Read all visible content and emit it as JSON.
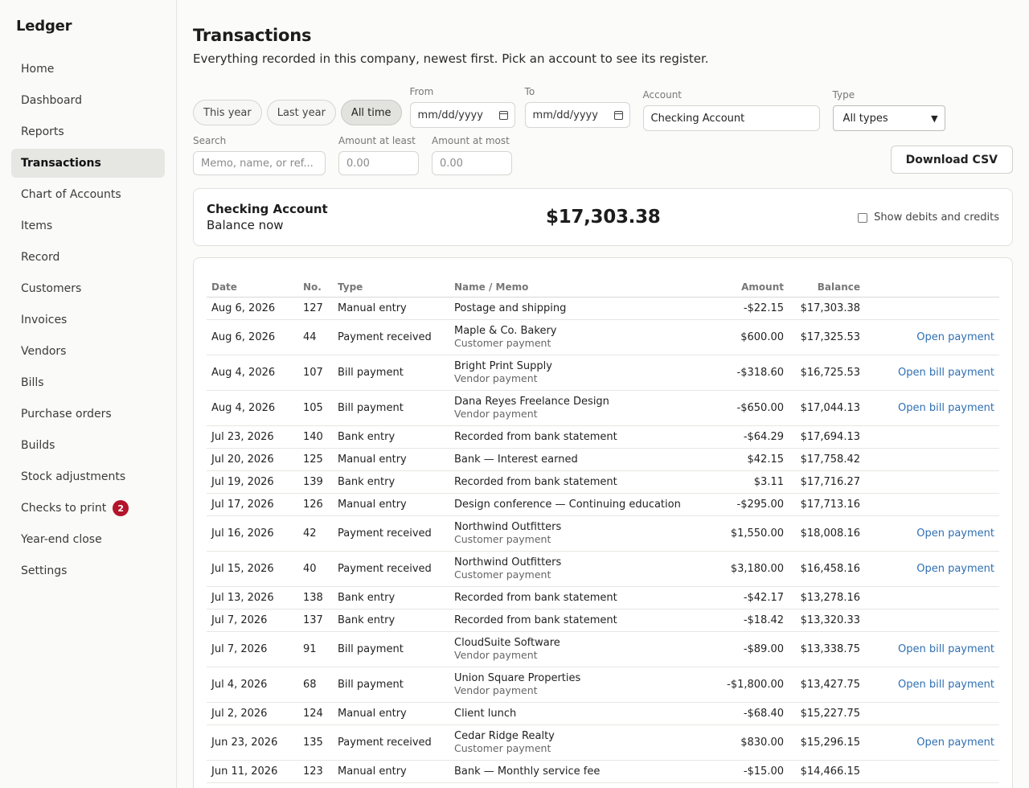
{
  "sidebar": {
    "brand": "Ledger",
    "items": [
      {
        "label": "Home"
      },
      {
        "label": "Dashboard"
      },
      {
        "label": "Reports"
      },
      {
        "label": "Transactions"
      },
      {
        "label": "Chart of Accounts"
      },
      {
        "label": "Items"
      },
      {
        "label": "Record"
      },
      {
        "label": "Customers"
      },
      {
        "label": "Invoices"
      },
      {
        "label": "Vendors"
      },
      {
        "label": "Bills"
      },
      {
        "label": "Purchase orders"
      },
      {
        "label": "Builds"
      },
      {
        "label": "Stock adjustments"
      },
      {
        "label": "Checks to print",
        "badge": "2"
      },
      {
        "label": "Year-end close"
      },
      {
        "label": "Settings"
      }
    ]
  },
  "header": {
    "title": "Transactions",
    "subtitle": "Everything recorded in this company, newest first. Pick an account to see its register."
  },
  "filters": {
    "ranges": [
      "This year",
      "Last year",
      "All time"
    ],
    "from_label": "From",
    "from_placeholder": "mm/dd/yyyy",
    "to_label": "To",
    "to_placeholder": "mm/dd/yyyy",
    "account_label": "Account",
    "account_value": "Checking Account",
    "type_label": "Type",
    "type_value": "All types",
    "search_label": "Search",
    "search_placeholder": "Memo, name, or ref...",
    "min_label": "Amount at least",
    "min_placeholder": "0.00",
    "max_label": "Amount at most",
    "max_placeholder": "0.00",
    "download_label": "Download CSV"
  },
  "balance": {
    "account": "Checking Account",
    "sub": "Balance now",
    "amount": "$17,303.38",
    "toggle_label": "Show debits and credits"
  },
  "table": {
    "headers": {
      "date": "Date",
      "no": "No.",
      "type": "Type",
      "name": "Name / Memo",
      "amount": "Amount",
      "balance": "Balance"
    },
    "rows": [
      {
        "date": "Aug 6, 2026",
        "no": "127",
        "type": "Manual entry",
        "name": "Postage and shipping",
        "sub": "",
        "amount": "-$22.15",
        "balance": "$17,303.38",
        "action": ""
      },
      {
        "date": "Aug 6, 2026",
        "no": "44",
        "type": "Payment received",
        "name": "Maple & Co. Bakery",
        "sub": "Customer payment",
        "amount": "$600.00",
        "balance": "$17,325.53",
        "action": "Open payment"
      },
      {
        "date": "Aug 4, 2026",
        "no": "107",
        "type": "Bill payment",
        "name": "Bright Print Supply",
        "sub": "Vendor payment",
        "amount": "-$318.60",
        "balance": "$16,725.53",
        "action": "Open bill payment"
      },
      {
        "date": "Aug 4, 2026",
        "no": "105",
        "type": "Bill payment",
        "name": "Dana Reyes Freelance Design",
        "sub": "Vendor payment",
        "amount": "-$650.00",
        "balance": "$17,044.13",
        "action": "Open bill payment"
      },
      {
        "date": "Jul 23, 2026",
        "no": "140",
        "type": "Bank entry",
        "name": "Recorded from bank statement",
        "sub": "",
        "amount": "-$64.29",
        "balance": "$17,694.13",
        "action": ""
      },
      {
        "date": "Jul 20, 2026",
        "no": "125",
        "type": "Manual entry",
        "name": "Bank — Interest earned",
        "sub": "",
        "amount": "$42.15",
        "balance": "$17,758.42",
        "action": ""
      },
      {
        "date": "Jul 19, 2026",
        "no": "139",
        "type": "Bank entry",
        "name": "Recorded from bank statement",
        "sub": "",
        "amount": "$3.11",
        "balance": "$17,716.27",
        "action": ""
      },
      {
        "date": "Jul 17, 2026",
        "no": "126",
        "type": "Manual entry",
        "name": "Design conference — Continuing education",
        "sub": "",
        "amount": "-$295.00",
        "balance": "$17,713.16",
        "action": ""
      },
      {
        "date": "Jul 16, 2026",
        "no": "42",
        "type": "Payment received",
        "name": "Northwind Outfitters",
        "sub": "Customer payment",
        "amount": "$1,550.00",
        "balance": "$18,008.16",
        "action": "Open payment"
      },
      {
        "date": "Jul 15, 2026",
        "no": "40",
        "type": "Payment received",
        "name": "Northwind Outfitters",
        "sub": "Customer payment",
        "amount": "$3,180.00",
        "balance": "$16,458.16",
        "action": "Open payment"
      },
      {
        "date": "Jul 13, 2026",
        "no": "138",
        "type": "Bank entry",
        "name": "Recorded from bank statement",
        "sub": "",
        "amount": "-$42.17",
        "balance": "$13,278.16",
        "action": ""
      },
      {
        "date": "Jul 7, 2026",
        "no": "137",
        "type": "Bank entry",
        "name": "Recorded from bank statement",
        "sub": "",
        "amount": "-$18.42",
        "balance": "$13,320.33",
        "action": ""
      },
      {
        "date": "Jul 7, 2026",
        "no": "91",
        "type": "Bill payment",
        "name": "CloudSuite Software",
        "sub": "Vendor payment",
        "amount": "-$89.00",
        "balance": "$13,338.75",
        "action": "Open bill payment"
      },
      {
        "date": "Jul 4, 2026",
        "no": "68",
        "type": "Bill payment",
        "name": "Union Square Properties",
        "sub": "Vendor payment",
        "amount": "-$1,800.00",
        "balance": "$13,427.75",
        "action": "Open bill payment"
      },
      {
        "date": "Jul 2, 2026",
        "no": "124",
        "type": "Manual entry",
        "name": "Client lunch",
        "sub": "",
        "amount": "-$68.40",
        "balance": "$15,227.75",
        "action": ""
      },
      {
        "date": "Jun 23, 2026",
        "no": "135",
        "type": "Payment received",
        "name": "Cedar Ridge Realty",
        "sub": "Customer payment",
        "amount": "$830.00",
        "balance": "$15,296.15",
        "action": "Open payment"
      },
      {
        "date": "Jun 11, 2026",
        "no": "123",
        "type": "Manual entry",
        "name": "Bank — Monthly service fee",
        "sub": "",
        "amount": "-$15.00",
        "balance": "$14,466.15",
        "action": ""
      }
    ]
  }
}
